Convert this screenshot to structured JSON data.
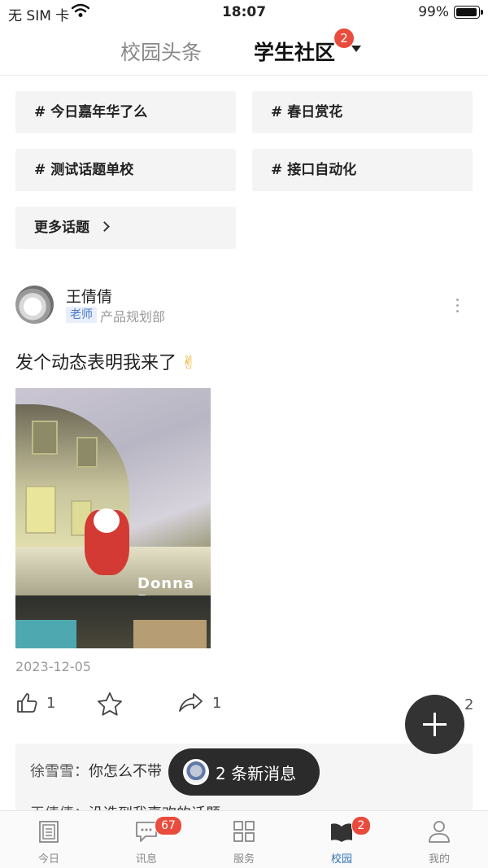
{
  "status_bar": {
    "carrier": "无 SIM 卡",
    "time": "18:07",
    "battery": "99%"
  },
  "header": {
    "tab_campus_news": "校园头条",
    "tab_student_community": "学生社区",
    "community_badge": "2"
  },
  "topics": {
    "items": [
      {
        "hash": "#",
        "label": "今日嘉年华了么"
      },
      {
        "hash": "#",
        "label": "春日赏花"
      },
      {
        "hash": "#",
        "label": "测试话题单校"
      },
      {
        "hash": "#",
        "label": "接口自动化"
      }
    ],
    "more_label": "更多话题"
  },
  "post": {
    "author": "王倩倩",
    "role": "老师",
    "department": "产品规划部",
    "text": "发个动态表明我来了",
    "emoji": "✌",
    "image_sign_text": "Donna D",
    "date": "2023-12-05",
    "like_count": "1",
    "share_count": "1",
    "comment_count": "2"
  },
  "comments": [
    {
      "who": "徐雪雪：",
      "text": "你怎么不带"
    },
    {
      "who": "王倩倩：",
      "text": "没选到我喜欢的话题"
    }
  ],
  "new_messages_pill": {
    "text": "2 条新消息"
  },
  "bottom_nav": {
    "items": [
      {
        "label": "今日",
        "icon": "document-icon"
      },
      {
        "label": "讯息",
        "icon": "chat-icon",
        "badge": "67"
      },
      {
        "label": "服务",
        "icon": "grid-icon"
      },
      {
        "label": "校园",
        "icon": "book-icon",
        "badge": "2"
      },
      {
        "label": "我的",
        "icon": "person-icon"
      }
    ],
    "active_index": 3
  },
  "colors": {
    "badge": "#e94b3c",
    "active_nav": "#2f6fb7",
    "chip_bg": "#f4f4f4",
    "pill_bg": "#2b2b2b"
  }
}
